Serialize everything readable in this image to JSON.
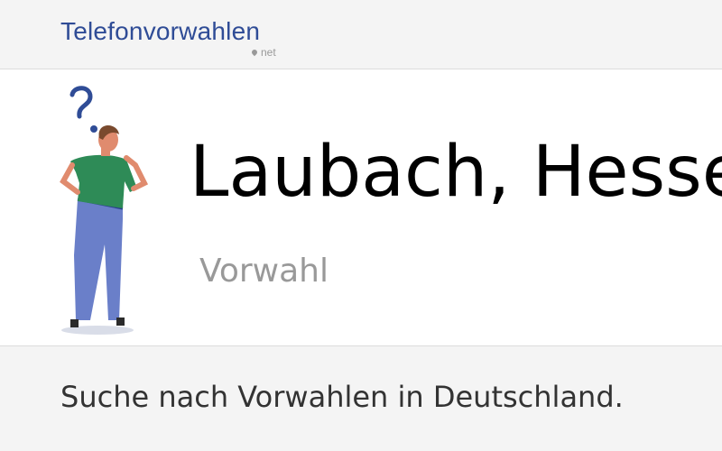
{
  "header": {
    "logo_text": "Telefonvorwahlen",
    "logo_subtext": "net"
  },
  "hero": {
    "title": "Laubach, Hessen",
    "subtitle": "Vorwahl"
  },
  "search": {
    "label": "Suche nach Vorwahlen in Deutschland."
  },
  "colors": {
    "brand": "#2f4c96",
    "muted": "#999999",
    "text": "#333333",
    "shirt": "#2e8b57",
    "pants": "#6a7fc9"
  },
  "icons": [
    "map-pin-icon",
    "question-mark-icon",
    "thinking-person-illustration"
  ]
}
